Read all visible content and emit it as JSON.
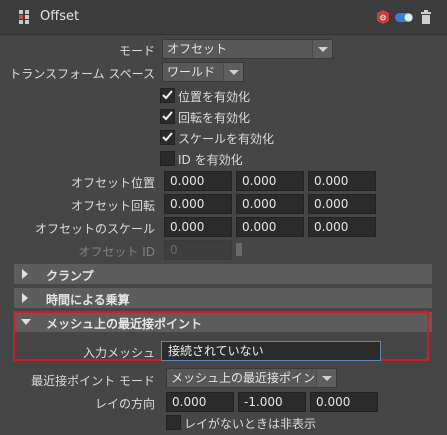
{
  "header": {
    "title": "Offset",
    "icons": [
      "node-icon",
      "preset-icon",
      "toggle-icon",
      "trash-icon"
    ]
  },
  "mode": {
    "label": "モード",
    "value": "オフセット"
  },
  "transform_space": {
    "label": "トランスフォーム スペース",
    "value": "ワールド"
  },
  "checkboxes": [
    {
      "label": "位置を有効化",
      "checked": true
    },
    {
      "label": "回転を有効化",
      "checked": true
    },
    {
      "label": "スケールを有効化",
      "checked": true
    },
    {
      "label": "ID を有効化",
      "checked": false
    }
  ],
  "offset_position": {
    "label": "オフセット位置",
    "values": [
      "0.000",
      "0.000",
      "0.000"
    ]
  },
  "offset_rotation": {
    "label": "オフセット回転",
    "values": [
      "0.000",
      "0.000",
      "0.000"
    ]
  },
  "offset_scale": {
    "label": "オフセットのスケール",
    "values": [
      "0.000",
      "0.000",
      "0.000"
    ]
  },
  "offset_id": {
    "label": "オフセット ID",
    "value": "0"
  },
  "sections": {
    "clamp": "クランプ",
    "time_multiply": "時間による乗算",
    "closest_point": "メッシュ上の最近接ポイント"
  },
  "input_mesh": {
    "label": "入力メッシュ",
    "value": "接続されていない"
  },
  "closest_point_mode": {
    "label": "最近接ポイント モード",
    "value": "メッシュ上の最近接ポイント"
  },
  "ray_direction": {
    "label": "レイの方向",
    "values": [
      "0.000",
      "-1.000",
      "0.000"
    ]
  },
  "hide_without_ray": {
    "label": "レイがないときは非表示",
    "checked": false
  },
  "colors": {
    "highlight": "#cc1f1f",
    "field_focus": "#5d87b8"
  }
}
